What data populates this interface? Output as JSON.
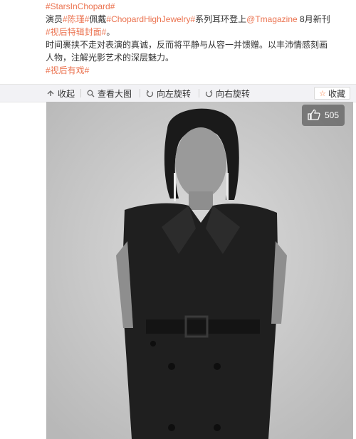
{
  "post": {
    "line1": {
      "tag": "#StarsInChopard#"
    },
    "line2": {
      "prefix": "演员",
      "tag1": "#陈瑾#",
      "mid": "佩戴",
      "tag2": "#ChopardHighJewelry#",
      "mid2": "系列耳环登上",
      "mention": "@Tmagazine",
      "suffix": " 8月新刊"
    },
    "line3": {
      "tag": "#视后特辑封面#",
      "suffix": "。"
    },
    "line4": "时间裹挟不走对表演的真诚，反而将平静与从容一并馈赠。以丰沛情感刻画",
    "line5": "人物，注解光影艺术的深层魅力。",
    "line6": {
      "tag": "#视后有戏#"
    }
  },
  "toolbar": {
    "collapse": "收起",
    "view_large": "查看大图",
    "rotate_left": "向左旋转",
    "rotate_right": "向右旋转",
    "favorite": "收藏"
  },
  "photo": {
    "likes": "505"
  }
}
